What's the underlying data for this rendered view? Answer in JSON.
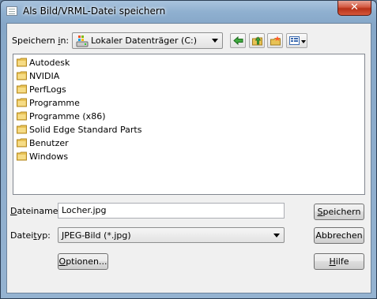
{
  "window": {
    "title": "Als Bild/VRML-Datei speichern",
    "close_glyph": "✕"
  },
  "location": {
    "label_pre": "Speichern ",
    "label_key": "i",
    "label_post": "n:",
    "selected": "Lokaler Datenträger (C:)",
    "drive_icon": "drive-icon"
  },
  "toolbar": {
    "back_icon": "back-arrow-icon",
    "up_icon": "up-folder-icon",
    "new_folder_icon": "new-folder-icon",
    "view_icon": "view-menu-icon"
  },
  "files": [
    {
      "name": "Autodesk"
    },
    {
      "name": "NVIDIA"
    },
    {
      "name": "PerfLogs"
    },
    {
      "name": "Programme"
    },
    {
      "name": "Programme (x86)"
    },
    {
      "name": "Solid Edge Standard Parts"
    },
    {
      "name": "Benutzer"
    },
    {
      "name": "Windows"
    }
  ],
  "filename": {
    "label_key": "D",
    "label_rest": "ateiname:",
    "value": "Locher.jpg"
  },
  "filetype": {
    "label_pre": "Datei",
    "label_key": "t",
    "label_post": "yp:",
    "selected": "JPEG-Bild (*.jpg)"
  },
  "buttons": {
    "save_key": "S",
    "save_rest": "peichern",
    "cancel": "Abbrechen",
    "options_key": "O",
    "options_rest": "ptionen...",
    "help_key": "H",
    "help_rest": "ilfe"
  },
  "colors": {
    "folder": "#e8c255",
    "close": "#c9442a"
  }
}
